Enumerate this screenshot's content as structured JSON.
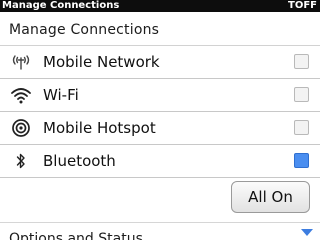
{
  "window": {
    "title": "Manage Connections",
    "status": "TOFF"
  },
  "section_header": "Manage Connections",
  "rows": [
    {
      "label": "Mobile Network",
      "icon": "mobile-network-icon",
      "checked": false
    },
    {
      "label": "Wi-Fi",
      "icon": "wifi-icon",
      "checked": false
    },
    {
      "label": "Mobile Hotspot",
      "icon": "hotspot-icon",
      "checked": false
    },
    {
      "label": "Bluetooth",
      "icon": "bluetooth-icon",
      "checked": true
    }
  ],
  "all_on_button": "All On",
  "footer_section": "Options and Status",
  "colors": {
    "titlebar_bg": "#0d0d0d",
    "checkbox_checked": "#4a8ef0",
    "chevron": "#3d7de0"
  }
}
